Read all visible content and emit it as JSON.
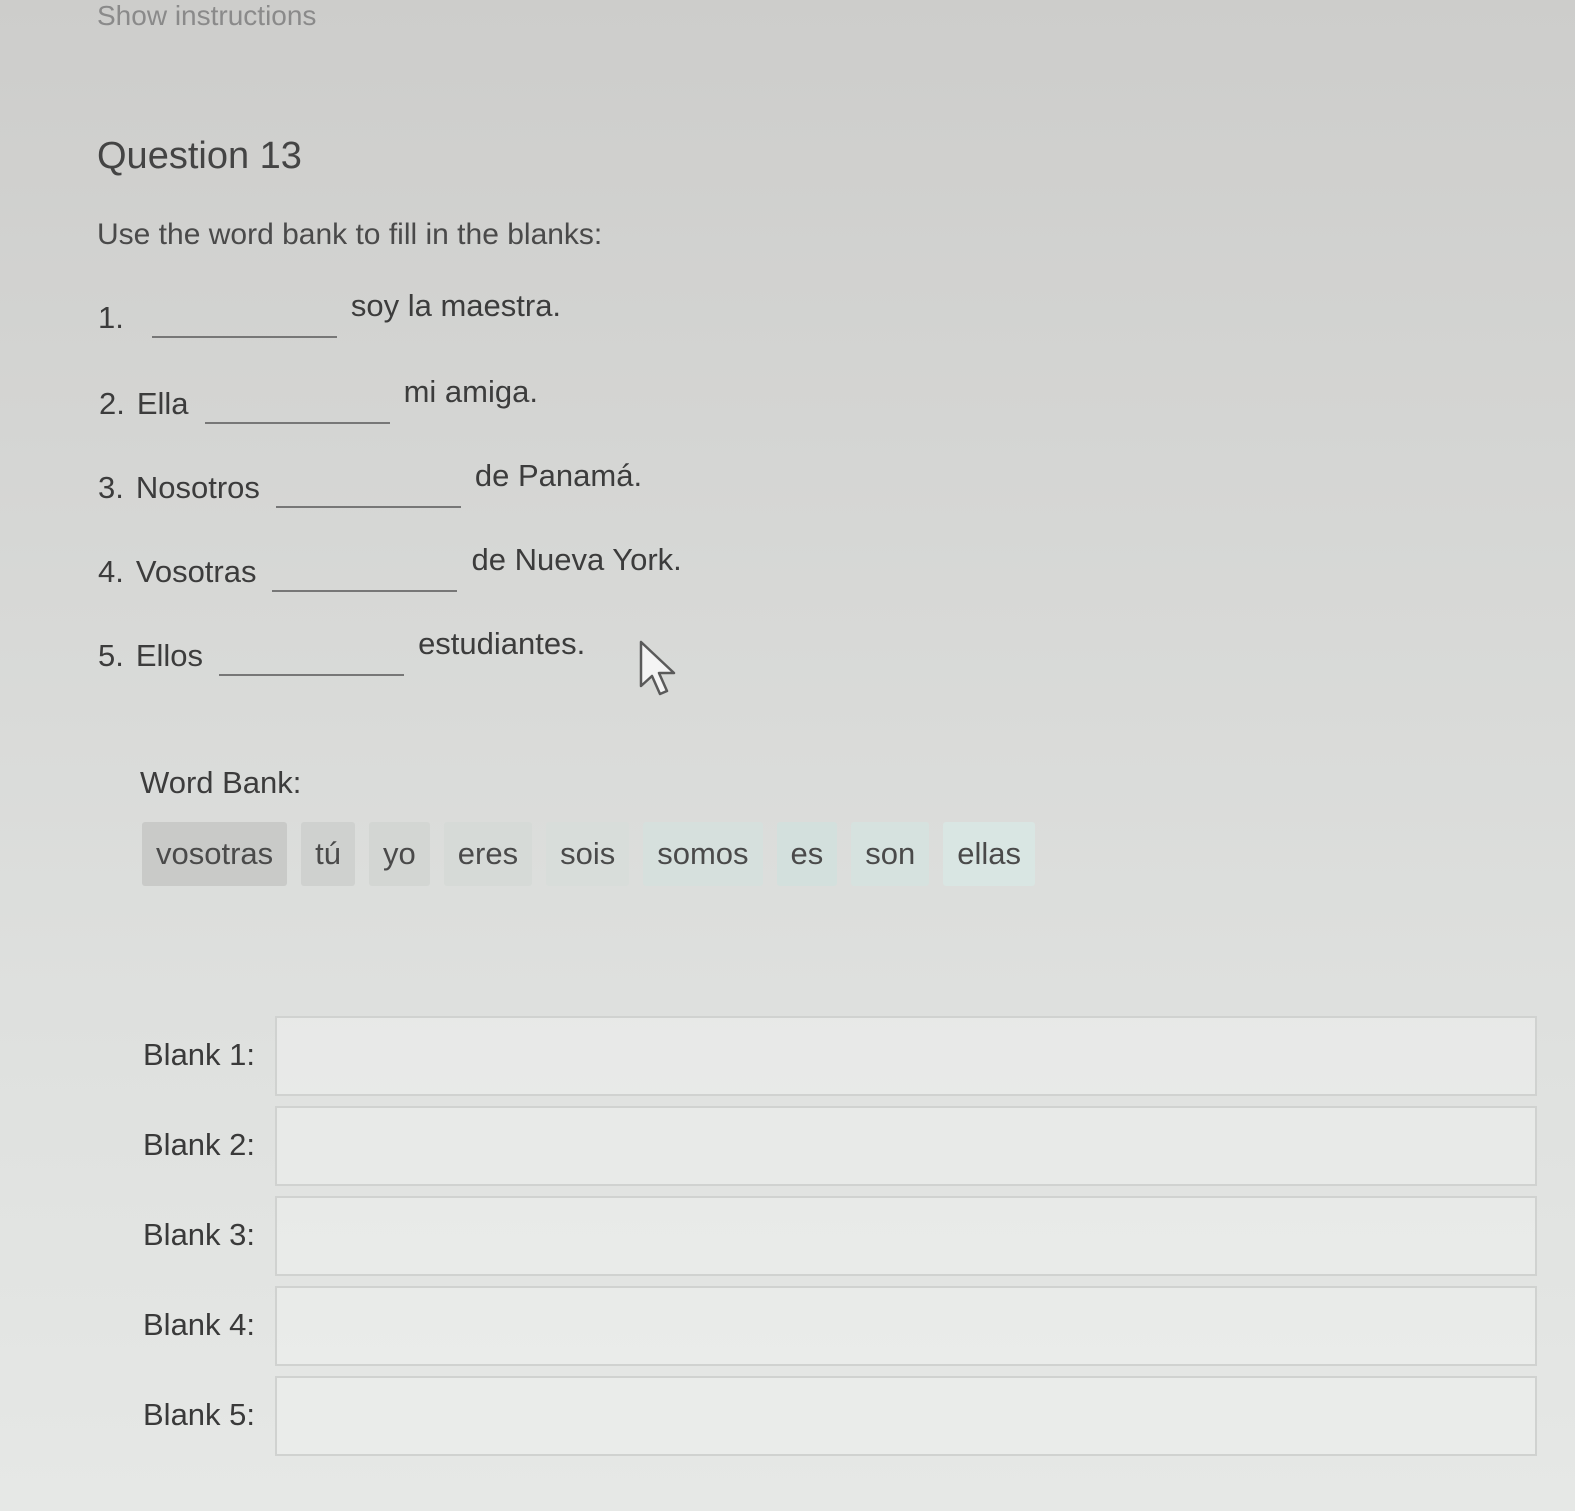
{
  "header": {
    "show_instructions": "Show instructions"
  },
  "question": {
    "title": "Question 13",
    "prompt": "Use the word bank to fill in the blanks:"
  },
  "sentences": [
    {
      "num": "1.",
      "subject": "",
      "rest": "soy la maestra."
    },
    {
      "num": "2.",
      "subject": "Ella",
      "rest": "mi amiga."
    },
    {
      "num": "3.",
      "subject": "Nosotros",
      "rest": "de Panamá."
    },
    {
      "num": "4.",
      "subject": "Vosotras",
      "rest": "de Nueva York."
    },
    {
      "num": "5.",
      "subject": "Ellos",
      "rest": "estudiantes."
    }
  ],
  "word_bank": {
    "label": "Word Bank:",
    "words": [
      "vosotras",
      "tú",
      "yo",
      "eres",
      "sois",
      "somos",
      "es",
      "son",
      "ellas"
    ]
  },
  "blanks": [
    {
      "label": "Blank 1:",
      "value": ""
    },
    {
      "label": "Blank 2:",
      "value": ""
    },
    {
      "label": "Blank 3:",
      "value": ""
    },
    {
      "label": "Blank 4:",
      "value": ""
    },
    {
      "label": "Blank 5:",
      "value": ""
    }
  ],
  "icons": {
    "cursor": "mouse-pointer-icon"
  }
}
